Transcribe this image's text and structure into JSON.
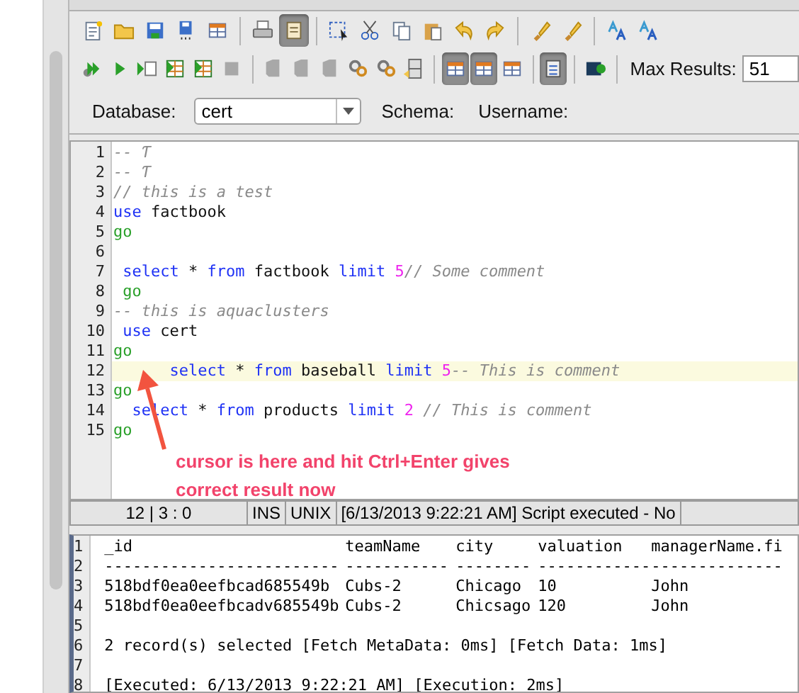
{
  "toolbar_rows": [
    [
      {
        "kind": "new-file",
        "pressed": false
      },
      {
        "kind": "folder",
        "pressed": false
      },
      {
        "kind": "save",
        "pressed": false
      },
      {
        "kind": "save-as",
        "pressed": false
      },
      {
        "kind": "table",
        "pressed": false
      },
      {
        "kind": "sep"
      },
      {
        "kind": "print",
        "pressed": false
      },
      {
        "kind": "document",
        "pressed": true
      },
      {
        "kind": "sep"
      },
      {
        "kind": "select",
        "pressed": false
      },
      {
        "kind": "cut",
        "pressed": false
      },
      {
        "kind": "copy",
        "pressed": false
      },
      {
        "kind": "paste",
        "pressed": false
      },
      {
        "kind": "undo",
        "pressed": false
      },
      {
        "kind": "redo",
        "pressed": false
      },
      {
        "kind": "sep"
      },
      {
        "kind": "brush",
        "pressed": false
      },
      {
        "kind": "brush",
        "pressed": false
      },
      {
        "kind": "sep"
      },
      {
        "kind": "font",
        "pressed": false
      },
      {
        "kind": "font",
        "pressed": false
      }
    ],
    [
      {
        "kind": "run-all",
        "pressed": false
      },
      {
        "kind": "run",
        "pressed": false
      },
      {
        "kind": "run-file",
        "pressed": false
      },
      {
        "kind": "grid",
        "pressed": false
      },
      {
        "kind": "grid",
        "pressed": false
      },
      {
        "kind": "stop",
        "pressed": false,
        "disabled": true
      },
      {
        "kind": "sep"
      },
      {
        "kind": "page",
        "pressed": false,
        "disabled": true
      },
      {
        "kind": "page",
        "pressed": false,
        "disabled": true
      },
      {
        "kind": "page",
        "pressed": false,
        "disabled": true
      },
      {
        "kind": "gears",
        "pressed": false
      },
      {
        "kind": "gears",
        "pressed": false
      },
      {
        "kind": "cabinet",
        "pressed": false
      },
      {
        "kind": "sep"
      },
      {
        "kind": "table",
        "pressed": true
      },
      {
        "kind": "table",
        "pressed": true
      },
      {
        "kind": "table",
        "pressed": false
      },
      {
        "kind": "sep"
      },
      {
        "kind": "form",
        "pressed": true
      },
      {
        "kind": "sep"
      },
      {
        "kind": "terminal",
        "pressed": false
      },
      {
        "kind": "sep"
      }
    ]
  ],
  "max_results": {
    "label": "Max Results:",
    "value": "51"
  },
  "database": {
    "label": "Database:",
    "value": "cert"
  },
  "schema": {
    "label": "Schema:"
  },
  "username": {
    "label": "Username:"
  },
  "editor_lines": [
    {
      "number": "1",
      "tokens": [
        {
          "kind": "comment",
          "text": "-- Ƭ"
        }
      ]
    },
    {
      "number": "2",
      "tokens": [
        {
          "kind": "comment",
          "text": "-- Ƭ"
        }
      ]
    },
    {
      "number": "3",
      "tokens": [
        {
          "kind": "comment",
          "text": "// this is a test"
        }
      ]
    },
    {
      "number": "4",
      "tokens": [
        {
          "kind": "keyword",
          "text": "use"
        },
        {
          "kind": "plain",
          "text": " factbook"
        }
      ]
    },
    {
      "number": "5",
      "tokens": [
        {
          "kind": "go",
          "text": "go"
        }
      ]
    },
    {
      "number": "6"
    },
    {
      "number": "7",
      "tokens": [
        {
          "kind": "keyword",
          "text": " select"
        },
        {
          "kind": "plain",
          "text": " * "
        },
        {
          "kind": "keyword",
          "text": "from"
        },
        {
          "kind": "plain",
          "text": " factbook "
        },
        {
          "kind": "keyword",
          "text": "limit"
        },
        {
          "kind": "number",
          "text": " 5"
        },
        {
          "kind": "comment",
          "text": "// Some comment"
        }
      ]
    },
    {
      "number": "8",
      "tokens": [
        {
          "kind": "go",
          "text": " go"
        }
      ]
    },
    {
      "number": "9",
      "tokens": [
        {
          "kind": "comment",
          "text": "-- this is aquaclusters"
        }
      ]
    },
    {
      "number": "10",
      "tokens": [
        {
          "kind": "keyword",
          "text": " use"
        },
        {
          "kind": "plain",
          "text": " cert"
        }
      ]
    },
    {
      "number": "11",
      "tokens": [
        {
          "kind": "go",
          "text": "go"
        }
      ]
    },
    {
      "number": "12",
      "current": true,
      "tokens": [
        {
          "kind": "keyword",
          "text": "      select"
        },
        {
          "kind": "plain",
          "text": " * "
        },
        {
          "kind": "keyword",
          "text": "from"
        },
        {
          "kind": "plain",
          "text": " baseball "
        },
        {
          "kind": "keyword",
          "text": "limit"
        },
        {
          "kind": "number",
          "text": " 5"
        },
        {
          "kind": "comment",
          "text": "-- This is comment"
        }
      ]
    },
    {
      "number": "13",
      "tokens": [
        {
          "kind": "go",
          "text": "go"
        }
      ]
    },
    {
      "number": "14",
      "tokens": [
        {
          "kind": "keyword",
          "text": "  select"
        },
        {
          "kind": "plain",
          "text": " * "
        },
        {
          "kind": "keyword",
          "text": "from"
        },
        {
          "kind": "plain",
          "text": " products "
        },
        {
          "kind": "keyword",
          "text": "limit"
        },
        {
          "kind": "number",
          "text": " 2"
        },
        {
          "kind": "comment",
          "text": " // This is comment"
        }
      ]
    },
    {
      "number": "15",
      "tokens": [
        {
          "kind": "go",
          "text": "go"
        }
      ]
    }
  ],
  "annotation": {
    "lines": [
      "cursor is here and hit Ctrl+Enter gives",
      "correct result now"
    ]
  },
  "status_bar": {
    "position": "12 | 3 : 0",
    "mode": "INS",
    "line_ending": "UNIX",
    "message": "[6/13/2013 9:22:21 AM] Script executed - No"
  },
  "results": [
    {
      "number": "1",
      "kind": "row",
      "cells": [
        "_id",
        "teamName",
        "city",
        "valuation",
        "managerName.fi"
      ]
    },
    {
      "number": "2",
      "kind": "row",
      "cells": [
        "-------------------------",
        "-----------",
        "--------",
        "------------",
        "--------------"
      ]
    },
    {
      "number": "3",
      "kind": "row",
      "cells": [
        "518bdf0ea0eefbcad685549b",
        "Cubs-2",
        "Chicago",
        "10",
        "John"
      ]
    },
    {
      "number": "4",
      "kind": "row",
      "cells": [
        "518bdf0ea0eefbcadv685549b",
        "Cubs-2",
        "Chicsago",
        "120",
        "John"
      ]
    },
    {
      "number": "5",
      "kind": "blank"
    },
    {
      "number": "6",
      "kind": "text",
      "text": "2 record(s) selected [Fetch MetaData: 0ms] [Fetch Data: 1ms]"
    },
    {
      "number": "7",
      "kind": "blank"
    },
    {
      "number": "8",
      "kind": "text",
      "text": "[Executed: 6/13/2013 9:22:21 AM] [Execution: 2ms]"
    }
  ]
}
